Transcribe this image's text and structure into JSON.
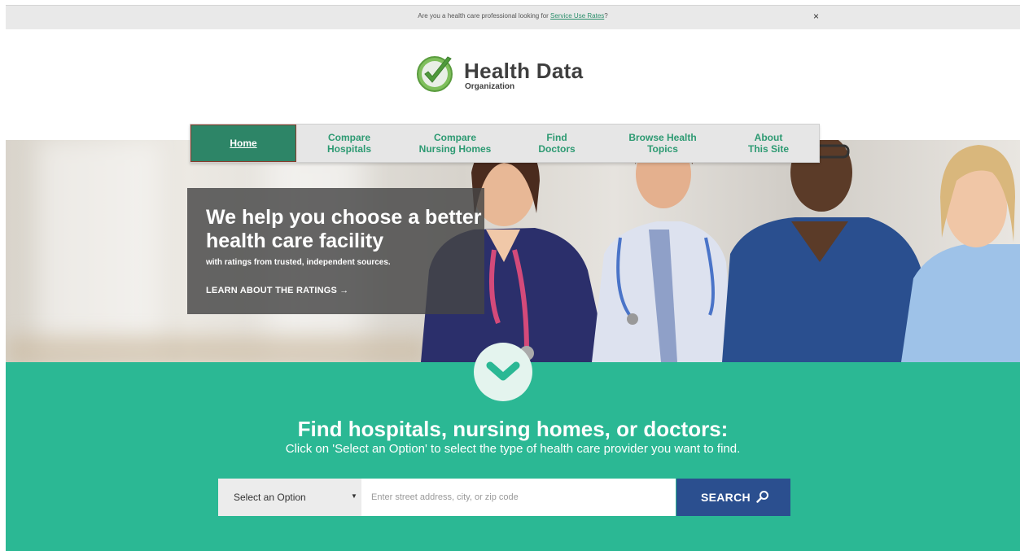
{
  "notice": {
    "text": "Are you a health care professional looking for ",
    "link_text": "Service Use Rates",
    "suffix": "?",
    "close_label": "×"
  },
  "logo": {
    "title": "Health Data",
    "subtitle": "Organization",
    "mark_icon": "checkmark-circle-icon",
    "colors": {
      "green": "#5aa84a",
      "check": "#ffffff"
    }
  },
  "nav": {
    "items": [
      {
        "line1": "Home",
        "line2": "",
        "active": true
      },
      {
        "line1": "Compare",
        "line2": "Hospitals",
        "active": false
      },
      {
        "line1": "Compare",
        "line2": "Nursing Homes",
        "active": false
      },
      {
        "line1": "Find",
        "line2": "Doctors",
        "active": false
      },
      {
        "line1": "Browse Health",
        "line2": "Topics",
        "active": false
      },
      {
        "line1": "About",
        "line2": "This Site",
        "active": false
      }
    ]
  },
  "hero": {
    "headline": "We help you choose a better health care facility",
    "subline": "with ratings from trusted, independent sources.",
    "link": "LEARN ABOUT THE RATINGS →"
  },
  "find": {
    "chevron_icon": "chevron-down-icon",
    "title": "Find hospitals, nursing homes, or doctors:",
    "subtitle": "Click on 'Select an Option' to select the type of health care provider you want to find.",
    "select_value": "Select an Option",
    "select_caret": "▼",
    "address_placeholder": "Enter street address, city, or zip code",
    "search_label": "SEARCH",
    "search_icon": "magnifier-icon"
  },
  "colors": {
    "brand_green": "#2bb894",
    "nav_active": "#2d8567",
    "search_button": "#2b4f8f"
  }
}
